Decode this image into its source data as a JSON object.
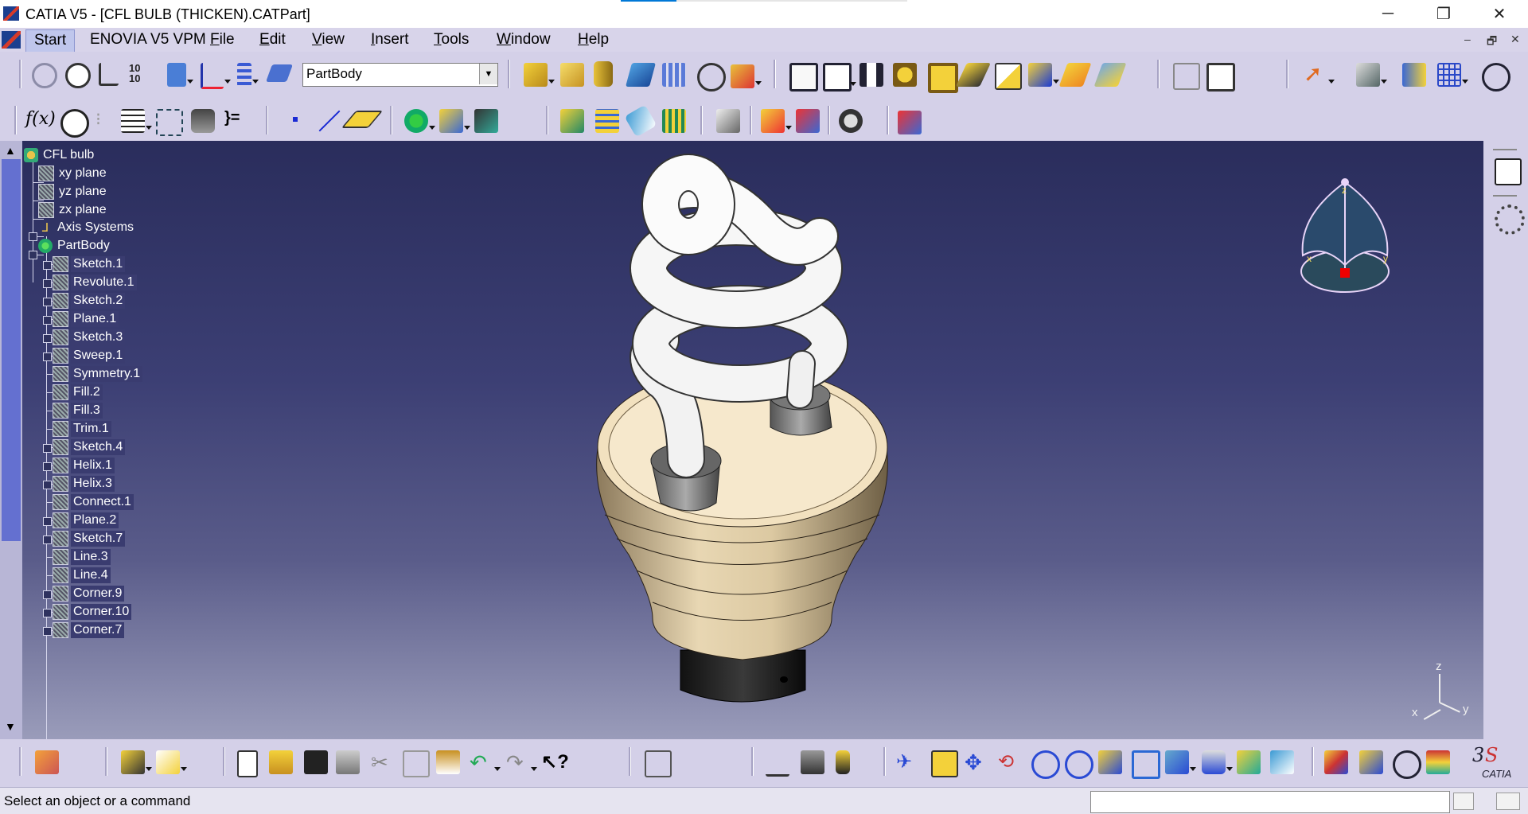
{
  "window": {
    "title": "CATIA V5 - [CFL BULB (THICKEN).CATPart]",
    "controls": {
      "minimize": "─",
      "restore": "❐",
      "close": "✕"
    }
  },
  "menubar": {
    "items": [
      "Start",
      "ENOVIA V5 VPM",
      "File",
      "Edit",
      "View",
      "Insert",
      "Tools",
      "Window",
      "Help"
    ],
    "mdi_controls": [
      "–",
      "🗗",
      "✕"
    ]
  },
  "toolbar": {
    "current_body": "PartBody"
  },
  "tree": {
    "root": "CFL bulb",
    "planes": [
      "xy plane",
      "yz plane",
      "zx plane"
    ],
    "axis_systems": "Axis Systems",
    "body": "PartBody",
    "features": [
      "Sketch.1",
      "Revolute.1",
      "Sketch.2",
      "Plane.1",
      "Sketch.3",
      "Sweep.1",
      "Symmetry.1",
      "Fill.2",
      "Fill.3",
      "Trim.1",
      "Sketch.4",
      "Helix.1",
      "Helix.3",
      "Connect.1",
      "Plane.2",
      "Sketch.7",
      "Line.3",
      "Line.4",
      "Corner.9",
      "Corner.10",
      "Corner.7"
    ]
  },
  "compass": {
    "x": "x",
    "y": "y",
    "z": "z"
  },
  "axis_triad": {
    "x": "x",
    "y": "y",
    "z": "z"
  },
  "brand": {
    "logo_text": "CATIA"
  },
  "status": {
    "message": "Select an object or a command"
  },
  "colors": {
    "viewport_top": "#2a2d5c",
    "viewport_bottom": "#9a9cba",
    "bulb_base": "#e3d2b0",
    "tube": "#f4f4f4",
    "selection": "#3a3c70"
  }
}
